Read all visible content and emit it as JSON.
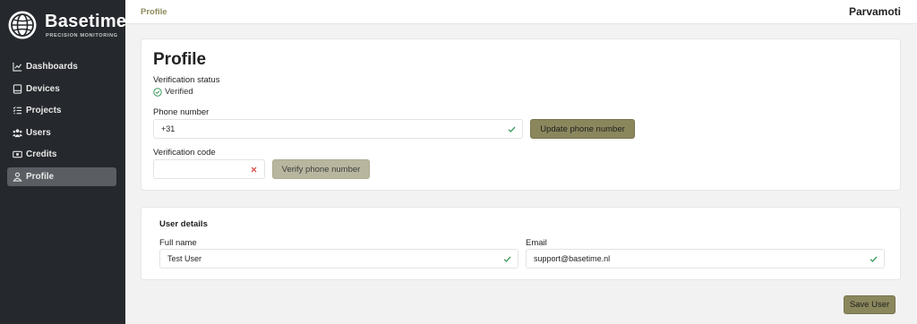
{
  "brand": {
    "name": "Basetime",
    "tagline": "PRECISION MONITORING"
  },
  "sidebar": {
    "items": [
      {
        "label": "Dashboards",
        "icon": "chart-line-icon",
        "active": false
      },
      {
        "label": "Devices",
        "icon": "device-icon",
        "active": false
      },
      {
        "label": "Projects",
        "icon": "list-check-icon",
        "active": false
      },
      {
        "label": "Users",
        "icon": "users-icon",
        "active": false
      },
      {
        "label": "Credits",
        "icon": "money-icon",
        "active": false
      },
      {
        "label": "Profile",
        "icon": "user-icon",
        "active": true
      }
    ]
  },
  "topbar": {
    "breadcrumb": "Profile",
    "organization": "Parvamoti"
  },
  "profile": {
    "title": "Profile",
    "verification_status_label": "Verification status",
    "verification_status": "Verified",
    "phone_label": "Phone number",
    "phone_value": "+31",
    "update_phone_button": "Update phone number",
    "code_label": "Verification code",
    "code_value": "",
    "verify_phone_button": "Verify phone number"
  },
  "user_details": {
    "title": "User details",
    "full_name_label": "Full name",
    "full_name_value": "Test User",
    "email_label": "Email",
    "email_value": "support@basetime.nl"
  },
  "save_button": "Save User",
  "colors": {
    "sidebar_bg": "#25282c",
    "accent": "#8b875d",
    "valid": "#3a9a5b",
    "invalid": "#d9534f"
  }
}
